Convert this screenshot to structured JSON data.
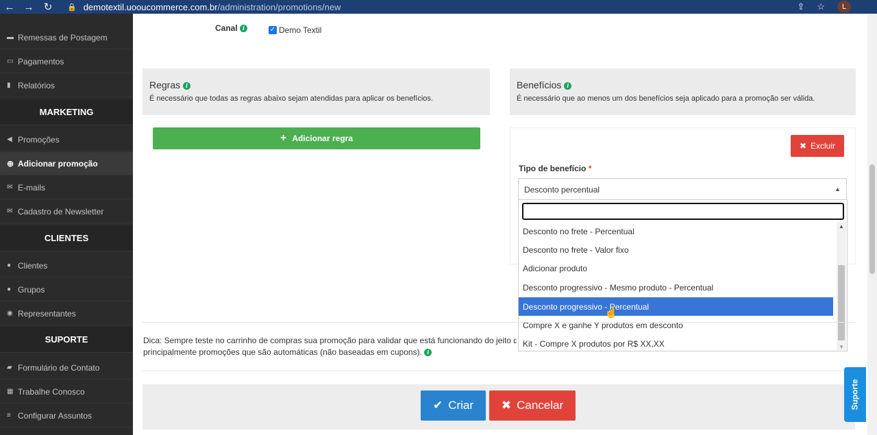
{
  "browser": {
    "url_host": "demotextil.uooucommerce.com.br",
    "url_path": "/administration/promotions/new",
    "avatar_letter": "L"
  },
  "sidebar": {
    "items_top": [
      {
        "label": "Remessas de Postagem",
        "icon": "truck-icon"
      },
      {
        "label": "Pagamentos",
        "icon": "credit-card-icon"
      },
      {
        "label": "Relatórios",
        "icon": "bar-chart-icon"
      }
    ],
    "sections": {
      "marketing": "MARKETING",
      "clientes": "CLIENTES",
      "suporte": "SUPORTE"
    },
    "marketing_items": [
      {
        "label": "Promoções",
        "icon": "megaphone-icon"
      },
      {
        "label": "Adicionar promoção",
        "icon": "plus-circle-icon",
        "active": true
      },
      {
        "label": "E-mails",
        "icon": "envelope-icon"
      },
      {
        "label": "Cadastro de Newsletter",
        "icon": "envelope-icon"
      }
    ],
    "clientes_items": [
      {
        "label": "Clientes",
        "icon": "user-icon"
      },
      {
        "label": "Grupos",
        "icon": "users-icon"
      },
      {
        "label": "Representantes",
        "icon": "user-circle-icon"
      }
    ],
    "suporte_items": [
      {
        "label": "Formulário de Contato",
        "icon": "comment-icon"
      },
      {
        "label": "Trabalhe Conosco",
        "icon": "briefcase-icon"
      },
      {
        "label": "Configurar Assuntos",
        "icon": "list-icon"
      }
    ]
  },
  "canal": {
    "label": "Canal",
    "option": "Demo Textil",
    "checked": true
  },
  "regras": {
    "title": "Regras",
    "description": "É necessário que todas as regras abaixo sejam atendidas para aplicar os benefícios.",
    "add_button": "Adicionar regra"
  },
  "beneficios": {
    "title": "Benefícios",
    "description": "É necessário que ao menos um dos benefícios seja aplicado para a promoção ser válida.",
    "delete_button": "Excluir",
    "tipo_label": "Tipo de benefício",
    "required_mark": "*",
    "selected": "Desconto percentual",
    "search_value": "",
    "options": [
      "Desconto no frete - Percentual",
      "Desconto no frete - Valor fixo",
      "Adicionar produto",
      "Desconto progressivo - Mesmo produto - Percentual",
      "Desconto progressivo - Percentual",
      "Compre X e ganhe Y produtos em desconto",
      "Kit - Compre X produtos por R$ XX,XX"
    ],
    "highlighted_index": 4
  },
  "dica": {
    "line1": "Dica: Sempre teste no carrinho de compras sua promoção para validar que está funcionando do jeito desejad",
    "line2": "principalmente promoções que são automáticas (não baseadas em cupons)."
  },
  "actions": {
    "criar": "Criar",
    "cancelar": "Cancelar"
  },
  "suporte_tab": "Suporte"
}
